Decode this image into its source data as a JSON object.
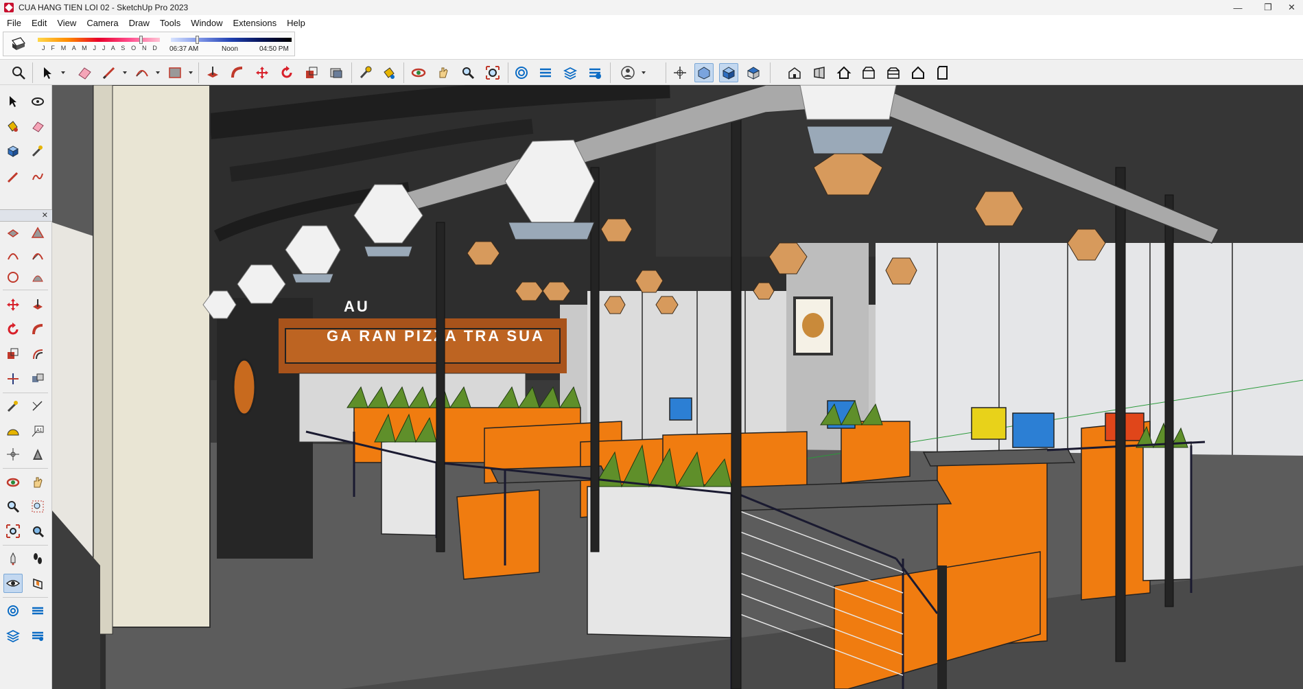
{
  "window": {
    "title": "CUA HANG TIEN LOI 02 - SketchUp Pro 2023",
    "minimize": "—",
    "maximize": "❐",
    "close": "✕"
  },
  "menu": [
    "File",
    "Edit",
    "View",
    "Camera",
    "Draw",
    "Tools",
    "Window",
    "Extensions",
    "Help"
  ],
  "shadows": {
    "months": "J F M A M J J A S O N D",
    "time_start": "06:37 AM",
    "time_mid": "Noon",
    "time_end": "04:50 PM"
  },
  "toolbar_icons": [
    "search-icon",
    "select-icon",
    "eraser-icon",
    "pencil-icon",
    "arc-icon",
    "rectangle-icon",
    "push-pull-icon",
    "follow-me-icon",
    "move-icon",
    "rotate-icon",
    "scale-icon",
    "offset-icon",
    "tape-measure-icon",
    "paint-bucket-icon",
    "orbit-icon",
    "pan-icon",
    "zoom-icon",
    "zoom-extents-icon",
    "warehouse-icon",
    "extension-warehouse-icon",
    "layout-icon",
    "extension-manager-icon",
    "profile-icon",
    "axes-icon",
    "xray-icon",
    "iso-view-icon",
    "top-view-icon",
    "front-view-icon",
    "right-view-icon",
    "back-view-icon",
    "left-view-icon",
    "bottom-view-icon"
  ],
  "left_icons": [
    "select-icon",
    "orbit-icon",
    "paint-bucket-icon",
    "eraser-icon",
    "component-icon",
    "tape-measure-icon",
    "pencil-icon",
    "freehand-icon",
    "rectangle-icon",
    "polygon-icon",
    "arc-icon",
    "pie-icon",
    "move-icon",
    "push-pull-icon",
    "rotate-icon",
    "follow-me-icon",
    "scale-icon",
    "offset-icon",
    "axes-icon",
    "section-icon",
    "protractor-icon",
    "text-icon",
    "axis-move-icon",
    "3d-text-icon",
    "orbit-icon",
    "pan-icon",
    "zoom-icon",
    "zoom-window-icon",
    "zoom-extents-icon",
    "previous-view-icon",
    "position-camera-icon",
    "walk-icon",
    "look-around-icon",
    "section-plane-icon",
    "warehouse-icon",
    "extension-icon",
    "layer-icon",
    "extension-manager-icon"
  ],
  "scene": {
    "sign_text": "GA RAN   PIZZA   TRA SUA",
    "sign_prefix": "AU"
  }
}
